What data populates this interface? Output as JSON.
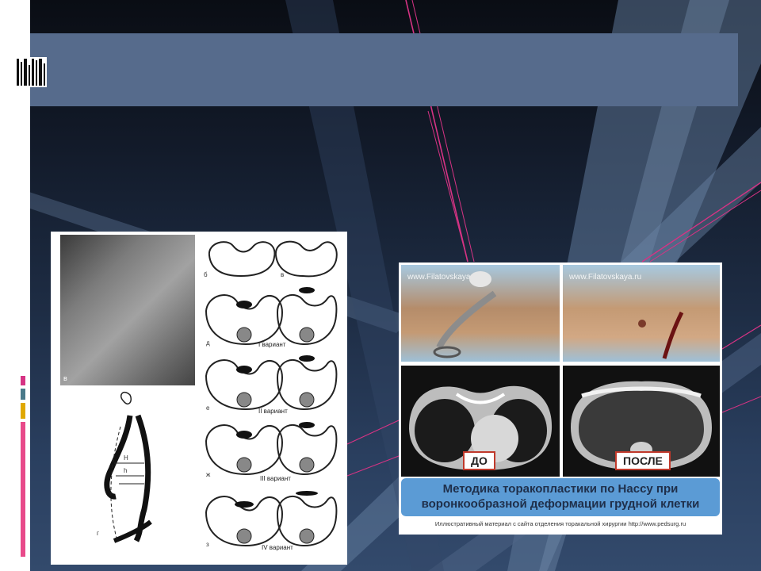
{
  "slide": {
    "title": "",
    "accent_colors": {
      "magenta": "#d63384",
      "teal": "#4a7a8a",
      "gold": "#e0a800",
      "pink": "#e84a8a"
    }
  },
  "figure_left": {
    "xray_label": "в",
    "labels": {
      "b": "б",
      "v": "в",
      "d": "д",
      "e": "е",
      "zh": "ж",
      "z": "з",
      "g": "г",
      "H": "H",
      "h": "h"
    },
    "variants": [
      "I вариант",
      "II вариант",
      "III вариант",
      "IV вариант"
    ]
  },
  "figure_right": {
    "watermark": "www.Filatovskaya.ru",
    "before_label": "ДО",
    "after_label": "ПОСЛЕ",
    "caption_line1": "Методика торакопластики по Нассу при",
    "caption_line2": "воронкообразной деформации грудной клетки",
    "credit": "Иллюстративный материал с сайта отделения торакальной хирургии http://www.pedsurg.ru"
  }
}
